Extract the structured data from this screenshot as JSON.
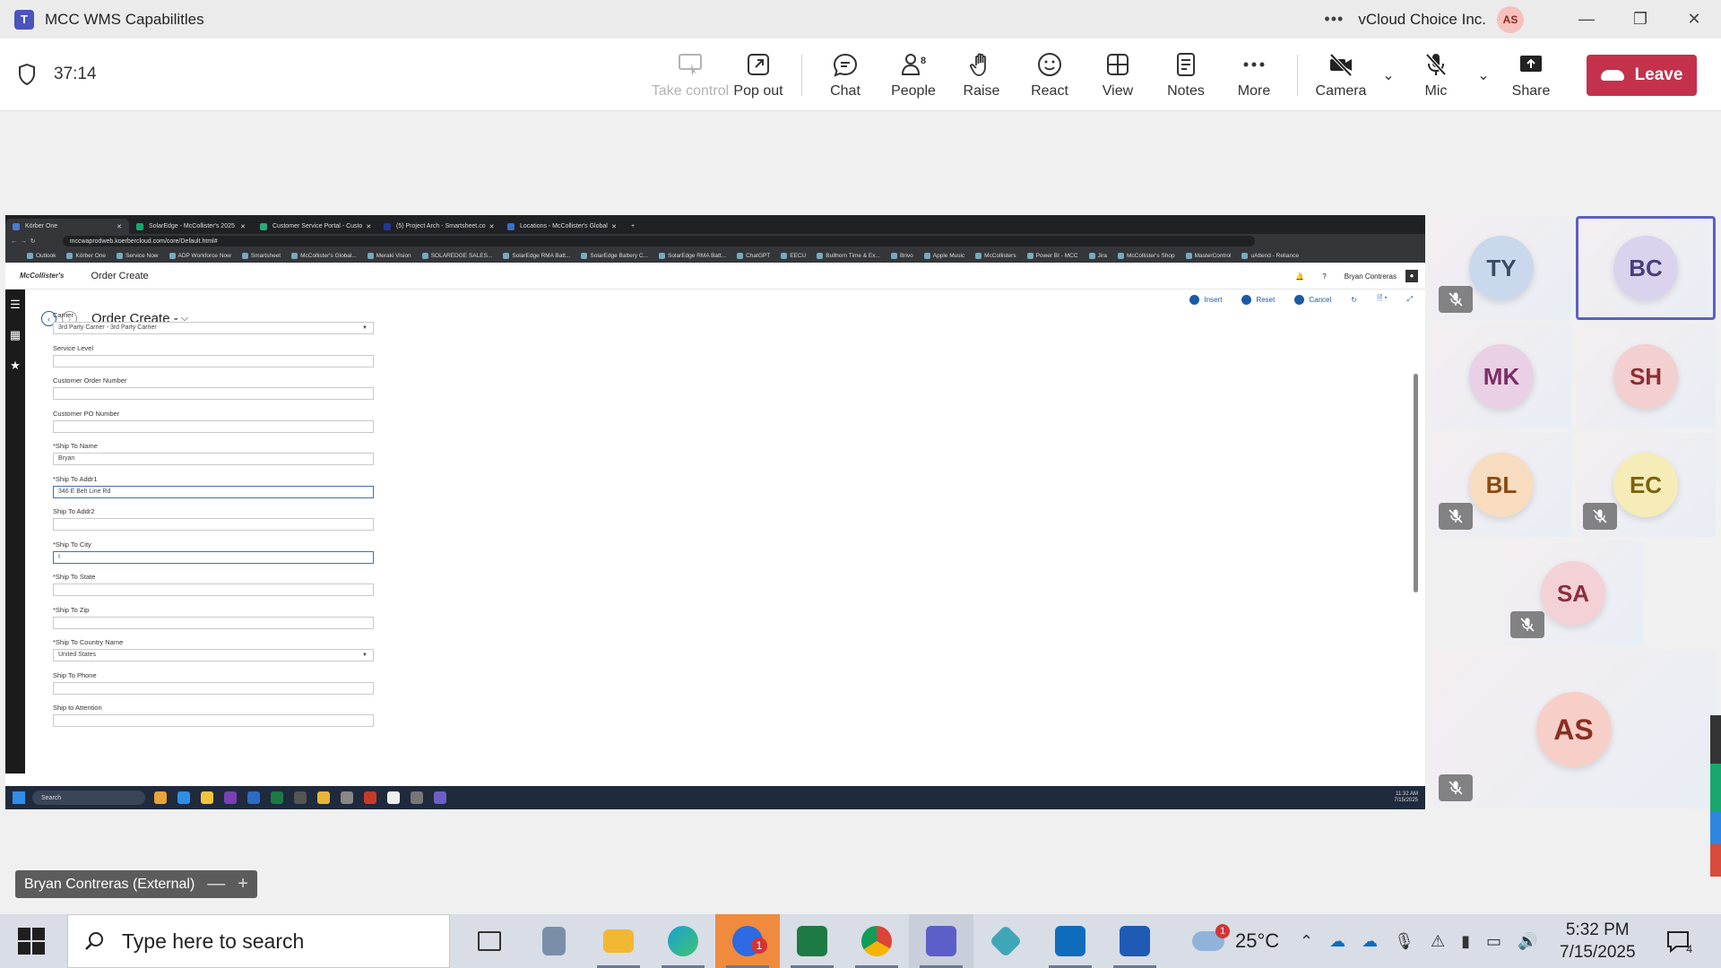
{
  "teams": {
    "window_title": "MCC WMS Capabilitles",
    "org_name": "vCloud Choice Inc.",
    "user_initials": "AS",
    "timer": "37:14",
    "toolbar": {
      "take_control": "Take control",
      "pop_out": "Pop out",
      "chat": "Chat",
      "people": "People",
      "people_count": "8",
      "raise": "Raise",
      "react": "React",
      "view": "View",
      "notes": "Notes",
      "more": "More",
      "camera": "Camera",
      "mic": "Mic",
      "share": "Share",
      "leave": "Leave"
    },
    "presenter_label": "Bryan Contreras (External)",
    "participants": [
      {
        "initials": "TY",
        "muted": true,
        "color": "#c9d8ec",
        "text": "#3b4a63"
      },
      {
        "initials": "BC",
        "muted": false,
        "color": "#d9d3ee",
        "text": "#4a3e7a"
      },
      {
        "initials": "MK",
        "muted": false,
        "color": "#ead0e4",
        "text": "#7a2f66"
      },
      {
        "initials": "SH",
        "muted": false,
        "color": "#f4cfd0",
        "text": "#8a2f33"
      },
      {
        "initials": "BL",
        "muted": true,
        "color": "#f7dcc0",
        "text": "#8a4a12"
      },
      {
        "initials": "EC",
        "muted": true,
        "color": "#f6ecb7",
        "text": "#7a6210"
      },
      {
        "initials": "SA",
        "muted": true,
        "color": "#f3d1d6",
        "text": "#8a2f3e"
      },
      {
        "initials": "AS",
        "muted": true,
        "color": "#f6cfc8",
        "text": "#8a2f22"
      }
    ]
  },
  "shared": {
    "tabs": [
      {
        "label": "Körber One",
        "color": "#4a7bd0"
      },
      {
        "label": "SolarEdge - McCollister's 2025",
        "color": "#1aa76b"
      },
      {
        "label": "Customer Service Portal - Custo",
        "color": "#2aa876"
      },
      {
        "label": "(5) Project Arch - Smartsheet.co",
        "color": "#1f3a93"
      },
      {
        "label": "Locations - McCollister's Global",
        "color": "#3b6fc4"
      }
    ],
    "url": "mccwaprodweb.koerbercloud.com/core/Default.html#",
    "bookmarks": [
      "Outlook",
      "Körber One",
      "Service Now",
      "ADP Workforce Now",
      "Smartsheet",
      "McCollister's Global...",
      "Meraki Vision",
      "SOLAREDGE SALES...",
      "SolarEdge RMA Batt...",
      "SolarEdge Battery C...",
      "SolarEdge RMA Batt...",
      "ChatGPT",
      "EECU",
      "Bullhorn Time & Ex...",
      "Brivo",
      "Apple Music",
      "McCollisters",
      "Power BI - MCC",
      "Jira",
      "McCollister's Shop",
      "MasterControl",
      "uAttend - Reliance"
    ],
    "app_logo": "McCollister's",
    "app_title": "Order Create",
    "user_name": "Bryan Contreras",
    "actions": {
      "insert": "Insert",
      "reset": "Reset",
      "cancel": "Cancel"
    },
    "page_title": "Order Create -",
    "fields": [
      {
        "label": "Carrier",
        "value": "3rd Party Carrier - 3rd Party Carrier",
        "dropdown": true
      },
      {
        "label": "Service Level",
        "value": ""
      },
      {
        "label": "Customer Order Number",
        "value": ""
      },
      {
        "label": "Customer PO Number",
        "value": ""
      },
      {
        "label": "*Ship To Name",
        "value": "Bryan"
      },
      {
        "label": "*Ship To Addr1",
        "value": "346 E Belt Line Rd",
        "focus": true
      },
      {
        "label": "Ship To Addr2",
        "value": ""
      },
      {
        "label": "*Ship To City",
        "value": "I",
        "focus": true
      },
      {
        "label": "*Ship To State",
        "value": ""
      },
      {
        "label": "*Ship To Zip",
        "value": ""
      },
      {
        "label": "*Ship To Country Name",
        "value": "United States",
        "dropdown": true
      },
      {
        "label": "Ship To Phone",
        "value": ""
      },
      {
        "label": "Ship to Attention",
        "value": ""
      }
    ],
    "taskbar_search": "Search",
    "clock_time": "11:32 AM",
    "clock_date": "7/15/2025"
  },
  "taskbar": {
    "search_placeholder": "Type here to search",
    "weather_temp": "25°C",
    "weather_badge": "1",
    "time": "5:32 PM",
    "date": "7/15/2025",
    "notif_count": "4",
    "outlook_badge": "1"
  }
}
